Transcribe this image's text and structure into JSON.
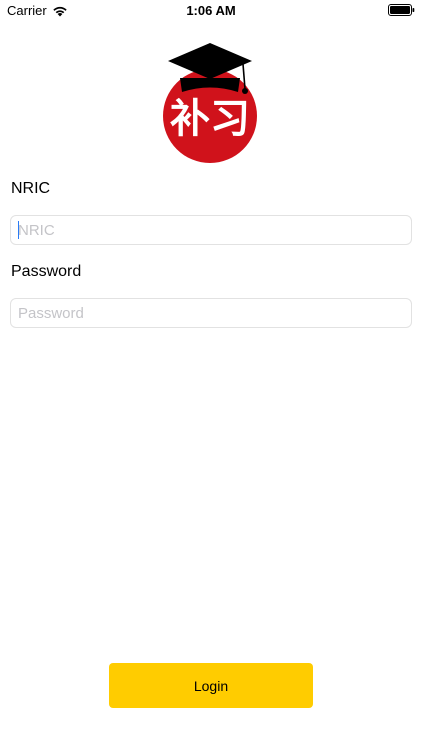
{
  "status_bar": {
    "carrier": "Carrier",
    "time": "1:06 AM",
    "wifi_icon": "wifi-icon",
    "battery_icon": "battery-icon"
  },
  "logo": {
    "text": "补习",
    "icon": "graduation-cap-icon",
    "circle_color": "#d0121b",
    "cap_color": "#000000"
  },
  "form": {
    "nric_label": "NRIC",
    "nric_placeholder": "NRIC",
    "nric_value": "",
    "password_label": "Password",
    "password_placeholder": "Password",
    "password_value": ""
  },
  "login_button": {
    "label": "Login",
    "color": "#ffcc00"
  }
}
